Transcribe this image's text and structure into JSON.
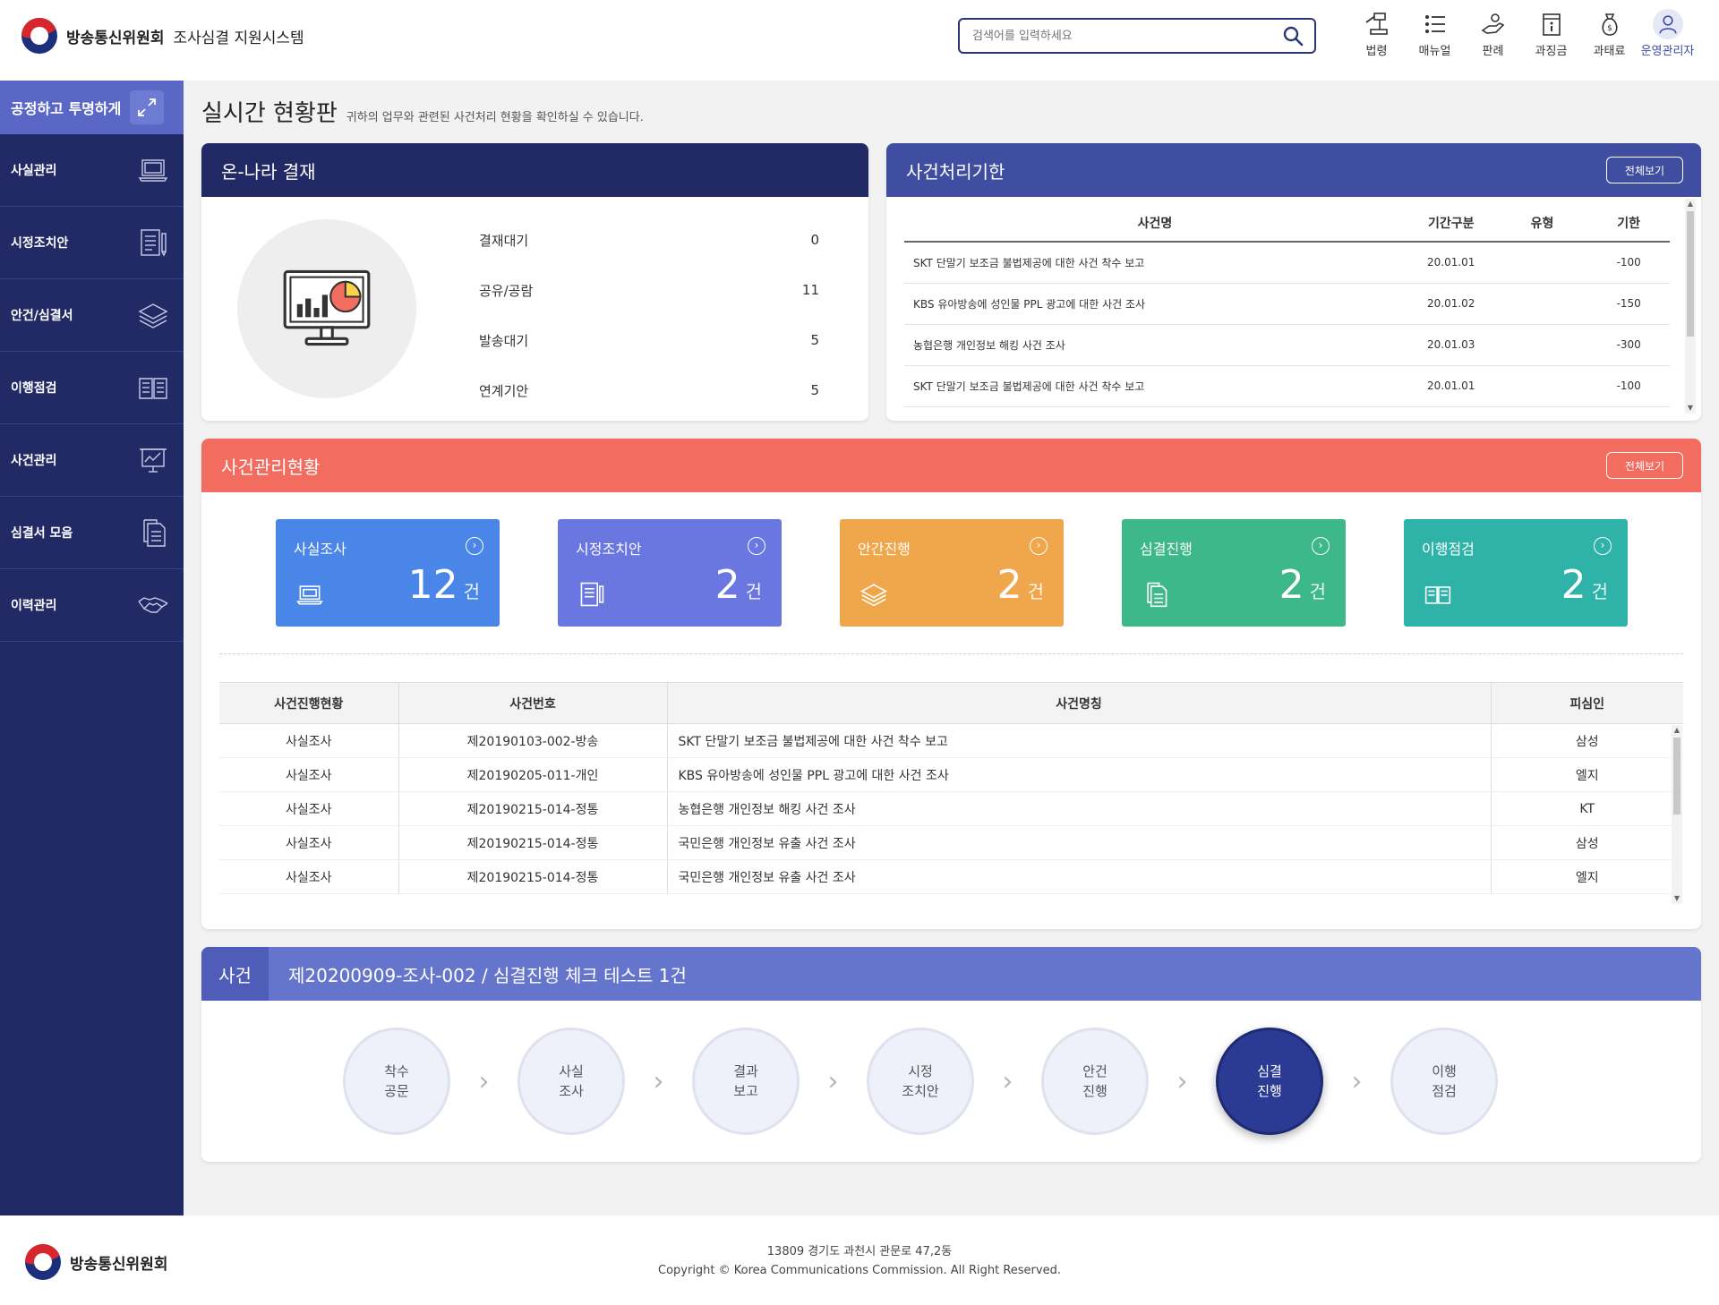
{
  "header": {
    "org_name": "방송통신위원회",
    "system_name": "조사심결 지원시스템",
    "search_placeholder": "검색어를 입력하세요",
    "nav": [
      {
        "label": "법령",
        "icon": "gavel-icon"
      },
      {
        "label": "매뉴얼",
        "icon": "list-icon"
      },
      {
        "label": "판례",
        "icon": "hand-icon"
      },
      {
        "label": "과징금",
        "icon": "notice-icon"
      },
      {
        "label": "과태료",
        "icon": "money-bag-icon"
      },
      {
        "label": "운영관리자",
        "icon": "user-icon"
      }
    ]
  },
  "sidebar": {
    "slogan": "공정하고 투명하게",
    "items": [
      {
        "label": "사실관리",
        "icon": "laptop-icon"
      },
      {
        "label": "시정조치안",
        "icon": "document-pen-icon"
      },
      {
        "label": "안건/심결서",
        "icon": "layers-icon"
      },
      {
        "label": "이행점검",
        "icon": "book-icon"
      },
      {
        "label": "사건관리",
        "icon": "presentation-icon"
      },
      {
        "label": "심결서 모음",
        "icon": "files-icon"
      },
      {
        "label": "이력관리",
        "icon": "handshake-icon"
      }
    ]
  },
  "page": {
    "title": "실시간 현황판",
    "subtitle": "귀하의 업무와 관련된 사건처리 현황을 확인하실 수 있습니다."
  },
  "approval": {
    "title": "온-나라 결재",
    "rows": [
      {
        "label": "결재대기",
        "value": "0"
      },
      {
        "label": "공유/공람",
        "value": "11"
      },
      {
        "label": "발송대기",
        "value": "5"
      },
      {
        "label": "연계기안",
        "value": "5"
      }
    ]
  },
  "deadline": {
    "title": "사건처리기한",
    "view_all": "전체보기",
    "columns": [
      "사건명",
      "기간구분",
      "유형",
      "기한"
    ],
    "rows": [
      {
        "name": "SKT 단말기 보조금 불법제공에 대한 사건 착수 보고",
        "period": "20.01.01",
        "type": "",
        "due": "-100"
      },
      {
        "name": "KBS 유아방송에 성인물 PPL 광고에 대한 사건 조사",
        "period": "20.01.02",
        "type": "",
        "due": "-150"
      },
      {
        "name": "농협은행 개인정보 해킹 사건 조사",
        "period": "20.01.03",
        "type": "",
        "due": "-300"
      },
      {
        "name": "SKT 단말기 보조금 불법제공에 대한 사건 착수 보고",
        "period": "20.01.01",
        "type": "",
        "due": "-100"
      }
    ]
  },
  "cases": {
    "title": "사건관리현황",
    "view_all": "전체보기",
    "tiles": [
      {
        "label": "사실조사",
        "count": "12",
        "unit": "건",
        "color": "#4a86e8",
        "icon": "laptop-icon"
      },
      {
        "label": "시정조치안",
        "count": "2",
        "unit": "건",
        "color": "#6a77e0",
        "icon": "document-pen-icon"
      },
      {
        "label": "안간진행",
        "count": "2",
        "unit": "건",
        "color": "#f0a64a",
        "icon": "layers-icon"
      },
      {
        "label": "심결진행",
        "count": "2",
        "unit": "건",
        "color": "#3db88b",
        "icon": "files-icon"
      },
      {
        "label": "이행점검",
        "count": "2",
        "unit": "건",
        "color": "#2fb3a8",
        "icon": "book-icon"
      }
    ],
    "columns": [
      "사건진행현황",
      "사건번호",
      "사건명칭",
      "피심인"
    ],
    "rows": [
      {
        "status": "사실조사",
        "number": "제20190103-002-방송",
        "name": "SKT 단말기 보조금 불법제공에 대한 사건 착수 보고",
        "respondent": "삼성"
      },
      {
        "status": "사실조사",
        "number": "제20190205-011-개인",
        "name": "KBS 유아방송에 성인물 PPL 광고에 대한 사건 조사",
        "respondent": "엘지"
      },
      {
        "status": "사실조사",
        "number": "제20190215-014-정통",
        "name": "농협은행 개인정보 해킹 사건 조사",
        "respondent": "KT"
      },
      {
        "status": "사실조사",
        "number": "제20190215-014-정통",
        "name": "국민은행 개인정보 유출 사건 조사",
        "respondent": "삼성"
      },
      {
        "status": "사실조사",
        "number": "제20190215-014-정통",
        "name": "국민은행 개인정보 유출 사건 조사",
        "respondent": "엘지"
      }
    ]
  },
  "process": {
    "label": "사건",
    "title": "제20200909-조사-002 / 심결진행 체크 테스트 1건",
    "steps": [
      {
        "label": "착수\n공문",
        "active": false
      },
      {
        "label": "사실\n조사",
        "active": false
      },
      {
        "label": "결과\n보고",
        "active": false
      },
      {
        "label": "시정\n조치안",
        "active": false
      },
      {
        "label": "안건\n진행",
        "active": false
      },
      {
        "label": "심결\n진행",
        "active": true
      },
      {
        "label": "이행\n점검",
        "active": false
      }
    ]
  },
  "footer": {
    "org_name": "방송통신위원회",
    "address": "13809 경기도 과천시 관문로 47,2동",
    "copyright": "Copyright © Korea Communications Commission. All Right Reserved."
  }
}
